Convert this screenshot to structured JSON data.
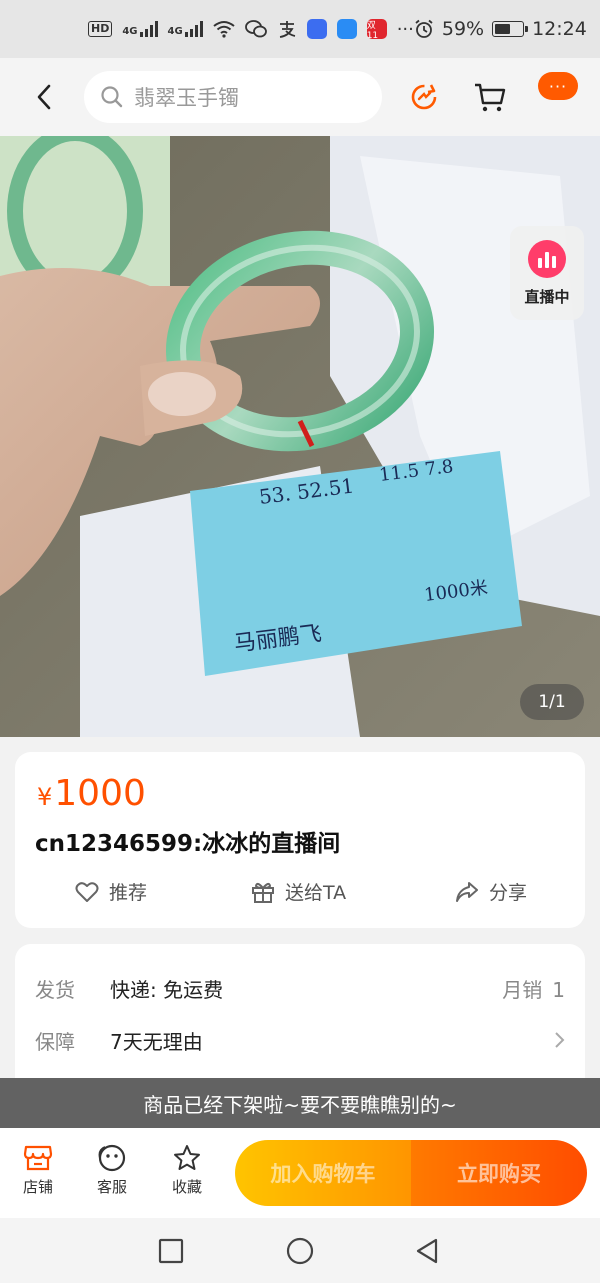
{
  "status_bar": {
    "hd": "HD",
    "net1": "4G",
    "net2": "4G",
    "battery_text": "59%",
    "battery_level": 0.59,
    "time": "12:24",
    "ellipsis": "···",
    "app_badge": "双11"
  },
  "header": {
    "search_text": "翡翠玉手镯",
    "more_label": "···"
  },
  "hero": {
    "live_label": "直播中",
    "counter": "1/1"
  },
  "product": {
    "currency": "¥",
    "price": "1000",
    "title": "cn12346599:冰冰的直播间",
    "actions": [
      {
        "label": "推荐"
      },
      {
        "label": "送给TA"
      },
      {
        "label": "分享"
      }
    ]
  },
  "info": {
    "rows": [
      {
        "label": "发货",
        "value": "快递: 免运费",
        "right_label": "月销",
        "right_value": "1"
      },
      {
        "label": "保障",
        "value": "7天无理由"
      }
    ]
  },
  "banner": {
    "text": "商品已经下架啦~要不要瞧瞧别的~"
  },
  "bottom_bar": {
    "tabs": [
      {
        "label": "店铺"
      },
      {
        "label": "客服"
      },
      {
        "label": "收藏"
      }
    ],
    "add_to_cart": "加入购物车",
    "buy_now": "立即购买"
  },
  "colors": {
    "accent": "#ff5000",
    "cart_gradient": [
      "#ffc400",
      "#ff9500"
    ],
    "buy_gradient": [
      "#ff7a00",
      "#ff4d00"
    ],
    "live_badge": "#ff3d6a"
  }
}
